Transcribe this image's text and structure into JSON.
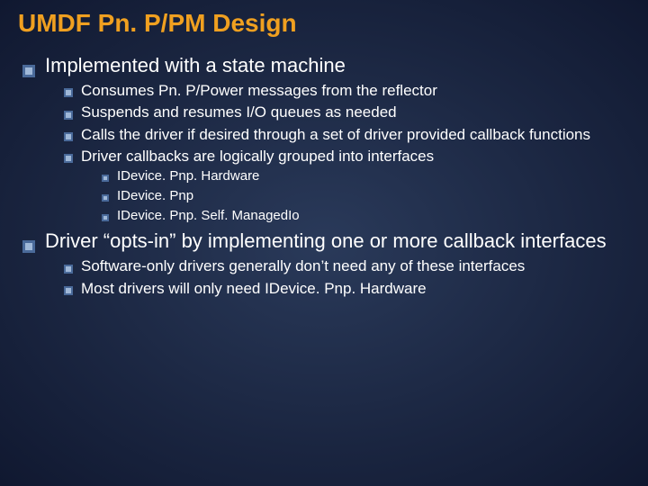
{
  "title": "UMDF Pn. P/PM Design",
  "points": [
    {
      "text": "Implemented with a state machine",
      "children": [
        {
          "text": "Consumes Pn. P/Power messages from the reflector"
        },
        {
          "text": "Suspends and resumes I/O queues as needed"
        },
        {
          "text": "Calls the driver if desired through a set of driver provided callback functions"
        },
        {
          "text": "Driver callbacks are logically grouped into interfaces",
          "children": [
            {
              "text": "IDevice. Pnp. Hardware"
            },
            {
              "text": "IDevice. Pnp"
            },
            {
              "text": "IDevice. Pnp. Self. ManagedIo"
            }
          ]
        }
      ]
    },
    {
      "text": "Driver “opts-in” by implementing one or more callback interfaces",
      "children": [
        {
          "text": "Software-only drivers generally don’t need any of these interfaces"
        },
        {
          "text": "Most drivers will only need IDevice. Pnp. Hardware"
        }
      ]
    }
  ],
  "bullet_colors": {
    "outer": "#4a6a9a",
    "inner": "#a0b8d8"
  }
}
